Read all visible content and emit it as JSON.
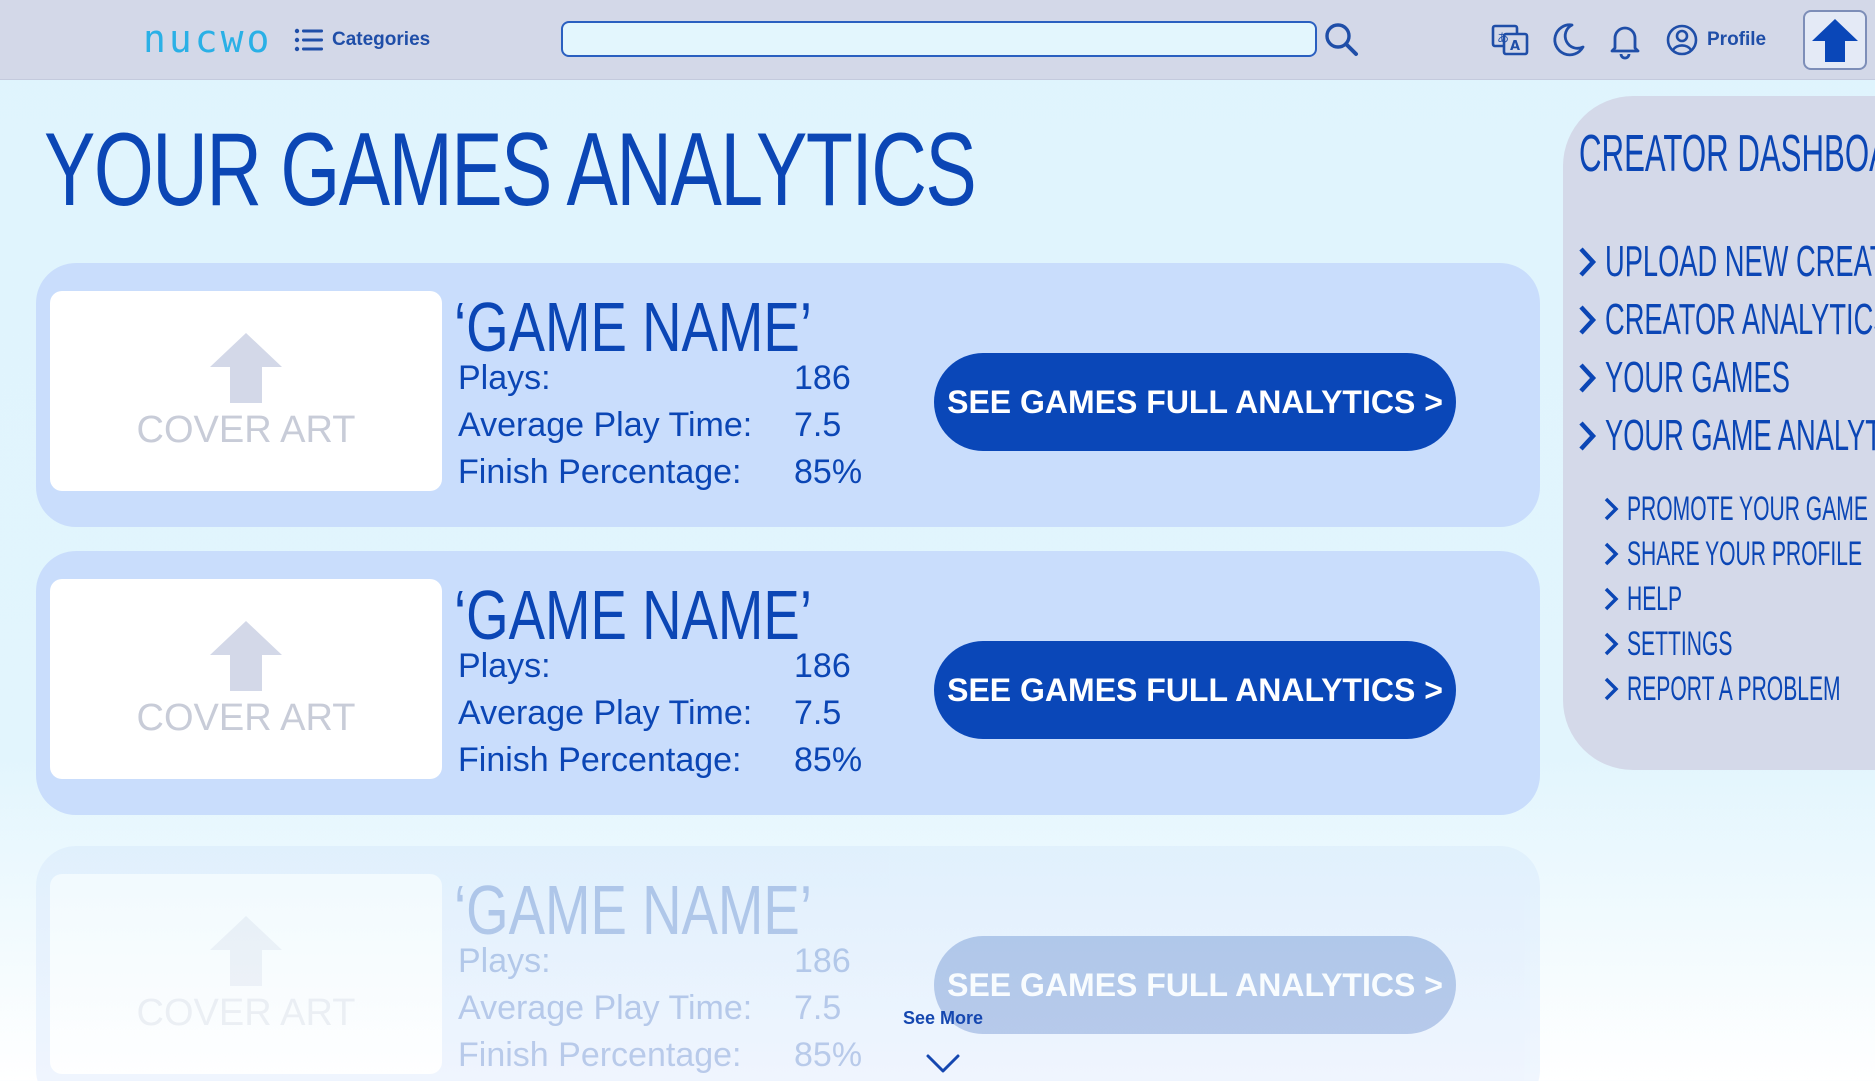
{
  "header": {
    "logo": "nucwo",
    "categories_label": "Categories",
    "search_placeholder": "",
    "profile_label": "Profile"
  },
  "page": {
    "title": "YOUR GAMES ANALYTICS"
  },
  "games": [
    {
      "name": "‘GAME NAME’",
      "cover_label": "COVER ART",
      "stats": [
        {
          "label": "Plays:",
          "value": "186"
        },
        {
          "label": "Average Play Time:",
          "value": "7.5"
        },
        {
          "label": "Finish Percentage:",
          "value": "85%"
        }
      ],
      "button_label": "SEE GAMES FULL ANALYTICS >"
    },
    {
      "name": "‘GAME NAME’",
      "cover_label": "COVER ART",
      "stats": [
        {
          "label": "Plays:",
          "value": "186"
        },
        {
          "label": "Average Play Time:",
          "value": "7.5"
        },
        {
          "label": "Finish Percentage:",
          "value": "85%"
        }
      ],
      "button_label": "SEE GAMES FULL ANALYTICS >"
    },
    {
      "name": "‘GAME NAME’",
      "cover_label": "COVER ART",
      "stats": [
        {
          "label": "Plays:",
          "value": "186"
        },
        {
          "label": "Average Play Time:",
          "value": "7.5"
        },
        {
          "label": "Finish Percentage:",
          "value": "85%"
        }
      ],
      "button_label": "SEE GAMES FULL ANALYTICS >"
    }
  ],
  "see_more": "See More",
  "dashboard": {
    "title": "CREATOR DASHBOARD",
    "main_items": [
      "UPLOAD NEW CREATION",
      "CREATOR ANALYTICS",
      "YOUR GAMES",
      "YOUR GAME ANALYTICS"
    ],
    "sub_items": [
      "PROMOTE YOUR GAME",
      "SHARE YOUR PROFILE",
      "HELP",
      "SETTINGS",
      "REPORT A PROBLEM"
    ]
  },
  "colors": {
    "header_bg": "#d3d8e8",
    "page_bg": "#dff4fd",
    "primary": "#0b46b5",
    "card_bg": "#c9ddfc",
    "logo": "#2ab0e6"
  },
  "icons": {
    "categories": "list-icon",
    "search": "search-icon",
    "translate": "translate-icon",
    "theme": "moon-icon",
    "notifications": "bell-icon",
    "profile": "user-circle-icon",
    "upload": "upload-arrow-icon",
    "cover": "upload-arrow-icon",
    "see_more": "chevron-down-icon",
    "menu_item": "chevron-right-icon"
  }
}
